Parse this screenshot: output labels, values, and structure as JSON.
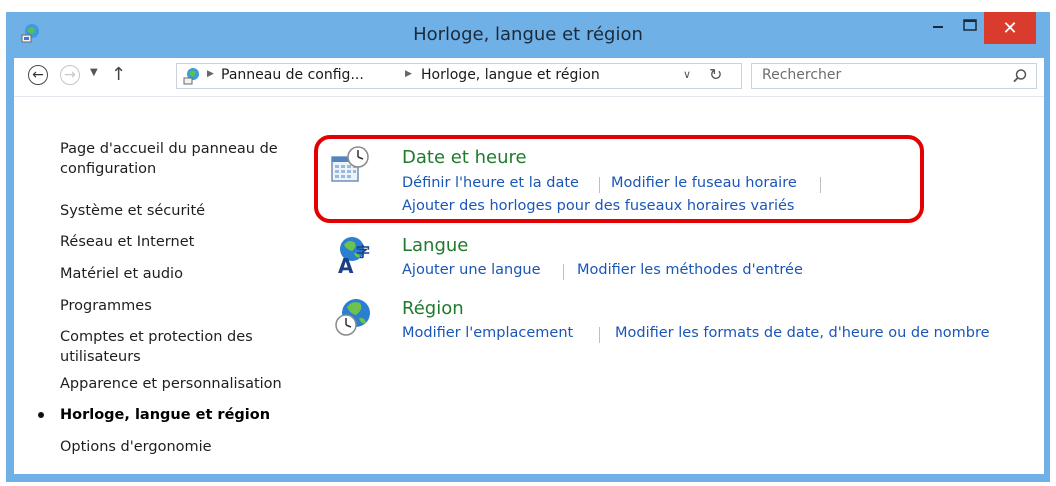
{
  "window": {
    "title": "Horloge, langue et région",
    "close_glyph": "✕",
    "controls": [
      "minimize-icon",
      "maximize-icon",
      "close-icon"
    ]
  },
  "navbar": {
    "breadcrumb": [
      "Panneau de config...",
      "Horloge, langue et région"
    ],
    "search_placeholder": "Rechercher"
  },
  "sidebar": {
    "items": [
      {
        "label": "Page d'accueil du panneau de configuration"
      },
      {
        "label": "Système et sécurité"
      },
      {
        "label": "Réseau et Internet"
      },
      {
        "label": "Matériel et audio"
      },
      {
        "label": "Programmes"
      },
      {
        "label": "Comptes et protection des utilisateurs"
      },
      {
        "label": "Apparence et personnalisation"
      },
      {
        "label": "Horloge, langue et région",
        "current": true
      },
      {
        "label": "Options d'ergonomie"
      }
    ]
  },
  "categories": [
    {
      "title": "Date et heure",
      "icon": "calendar-clock-icon",
      "links": [
        "Définir l'heure et la date",
        "Modifier le fuseau horaire",
        "Ajouter des horloges pour des fuseaux horaires variés"
      ]
    },
    {
      "title": "Langue",
      "icon": "language-globe-icon",
      "links": [
        "Ajouter une langue",
        "Modifier les méthodes d'entrée"
      ]
    },
    {
      "title": "Région",
      "icon": "globe-clock-icon",
      "links": [
        "Modifier l'emplacement",
        "Modifier les formats de date, d'heure ou de nombre"
      ]
    }
  ],
  "colors": {
    "titlebar": "#6fb0e6",
    "close_button": "#d93b2c",
    "category_title": "#1f7a2d",
    "link": "#1a56b8",
    "highlight": "#e40000"
  }
}
